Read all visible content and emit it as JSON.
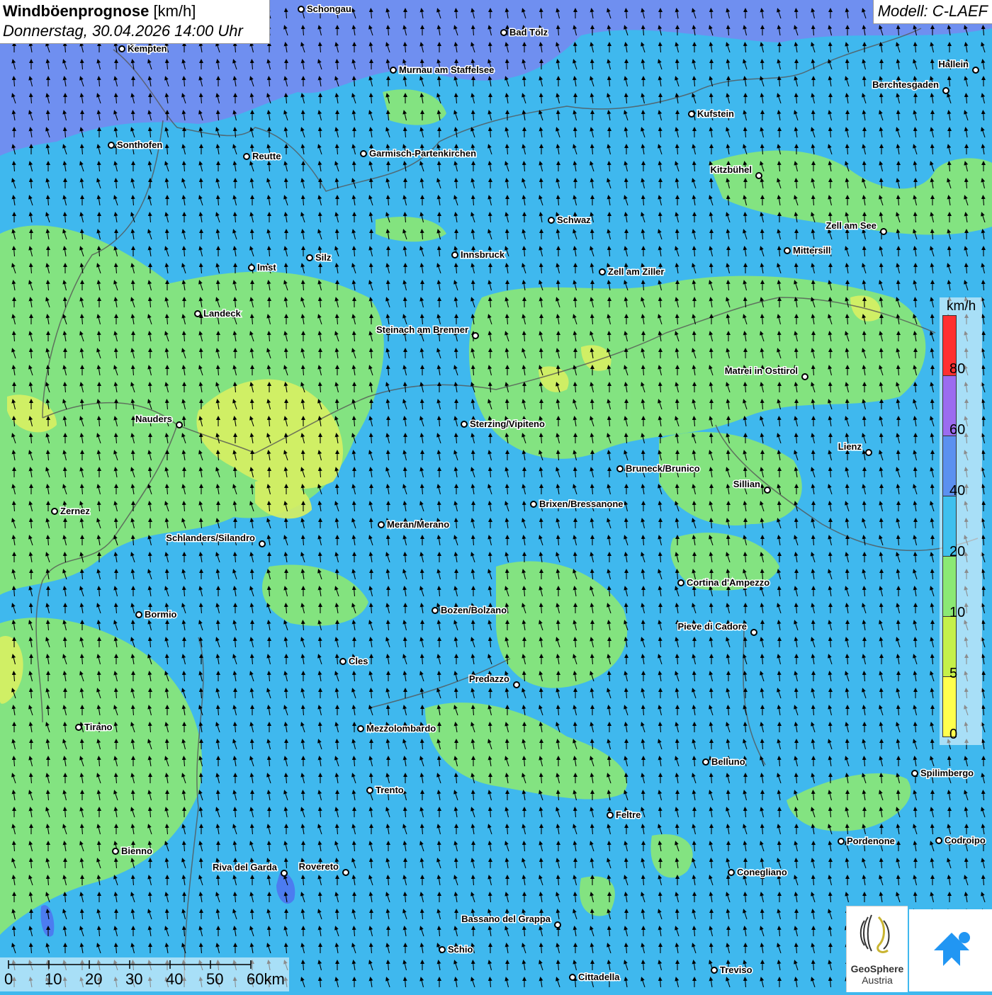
{
  "title": {
    "name_bold": "Windböenprognose",
    "unit": "[km/h]",
    "date": "Donnerstag, 30.04.2026 14:00 Uhr"
  },
  "model": "Modell: C-LAEF",
  "legend": {
    "unit": "km/h",
    "ticks": [
      "0",
      "5",
      "10",
      "20",
      "40",
      "60",
      "80"
    ],
    "colors": [
      "#ffff4d",
      "#c5f04a",
      "#8be874",
      "#3fc0ee",
      "#5b90f0",
      "#9b6cf0",
      "#ff3030"
    ]
  },
  "scale_bar": {
    "labels": [
      "0",
      "10",
      "20",
      "30",
      "40",
      "50",
      "60km"
    ]
  },
  "wind_direction": "from south (arrows point north)",
  "cities": [
    {
      "name": "Schongau"
    },
    {
      "name": "Bad Tölz"
    },
    {
      "name": "Kempten"
    },
    {
      "name": "Murnau am Staffelsee"
    },
    {
      "name": "Hallein"
    },
    {
      "name": "Berchtesgaden"
    },
    {
      "name": "Kufstein"
    },
    {
      "name": "Sonthofen"
    },
    {
      "name": "Reutte"
    },
    {
      "name": "Garmisch-Partenkirchen"
    },
    {
      "name": "Kitzbühel"
    },
    {
      "name": "Schwaz"
    },
    {
      "name": "Zell am See"
    },
    {
      "name": "Innsbruck"
    },
    {
      "name": "Mittersill"
    },
    {
      "name": "Silz"
    },
    {
      "name": "Imst"
    },
    {
      "name": "Zell am Ziller"
    },
    {
      "name": "Landeck"
    },
    {
      "name": "Steinach am Brenner"
    },
    {
      "name": "Matrei in Osttirol"
    },
    {
      "name": "Nauders"
    },
    {
      "name": "Sterzing/Vipiteno"
    },
    {
      "name": "Lienz"
    },
    {
      "name": "Bruneck/Brunico"
    },
    {
      "name": "Sillian"
    },
    {
      "name": "Brixen/Bressanone"
    },
    {
      "name": "Zernez"
    },
    {
      "name": "Meran/Merano"
    },
    {
      "name": "Schlanders/Silandro"
    },
    {
      "name": "Cortina d'Ampezzo"
    },
    {
      "name": "Bozen/Bolzano"
    },
    {
      "name": "Bormio"
    },
    {
      "name": "Pieve di Cadore"
    },
    {
      "name": "Cles"
    },
    {
      "name": "Predazzo"
    },
    {
      "name": "Tirano"
    },
    {
      "name": "Mezzolombardo"
    },
    {
      "name": "Belluno"
    },
    {
      "name": "Spilimbergo"
    },
    {
      "name": "Trento"
    },
    {
      "name": "Feltre"
    },
    {
      "name": "Pordenone"
    },
    {
      "name": "Codroipo"
    },
    {
      "name": "Bienno"
    },
    {
      "name": "Riva del Garda"
    },
    {
      "name": "Rovereto"
    },
    {
      "name": "Conegliano"
    },
    {
      "name": "Bassano del Grappa"
    },
    {
      "name": "Schio"
    },
    {
      "name": "Treviso"
    },
    {
      "name": "Cittadella"
    }
  ],
  "logos": {
    "geosphere_name": "GeoSphere",
    "geosphere_sub": "Austria"
  }
}
